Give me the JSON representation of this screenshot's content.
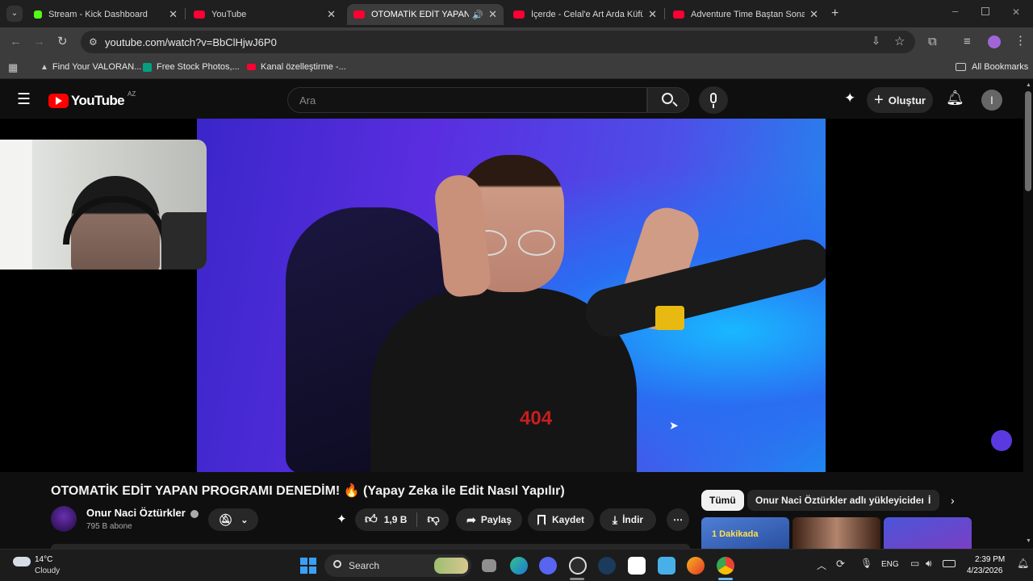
{
  "browser": {
    "tabs": [
      {
        "title": "Stream - Kick Dashboard",
        "icon": "kick-icon",
        "color": "#53fc18"
      },
      {
        "title": "YouTube",
        "icon": "youtube-icon",
        "color": "#ff0033"
      },
      {
        "title": "OTOMATİK EDİT YAPAN PRO",
        "icon": "youtube-icon",
        "color": "#ff0033"
      },
      {
        "title": "İçerde - Celal'e Art Arda Küfürle",
        "icon": "youtube-icon",
        "color": "#ff0033"
      },
      {
        "title": "Adventure Time Baştan Sona Tü",
        "icon": "youtube-icon",
        "color": "#ff0033"
      }
    ],
    "url": "youtube.com/watch?v=BbClHjwJ6P0",
    "bookmarks": [
      {
        "label": "Find Your VALORAN...",
        "icon": "valorant-icon"
      },
      {
        "label": "Free Stock Photos,...",
        "icon": "pexels-icon"
      },
      {
        "label": "Kanal özelleştirme -...",
        "icon": "youtube-icon"
      }
    ],
    "all_bookmarks": "All Bookmarks"
  },
  "youtube": {
    "logo": "YouTube",
    "region": "AZ",
    "search_placeholder": "Ara",
    "create_label": "Oluştur",
    "avatar_letter": "I",
    "video": {
      "shirt_text": "404",
      "title": "OTOMATİK EDİT YAPAN PROGRAMI DENEDİM! 🔥 (Yapay Zeka ile Edit Nasıl Yapılır)",
      "channel": "Onur Naci Öztürkler",
      "subscribers": "795 B abone",
      "likes": "1,9 B",
      "share": "Paylaş",
      "save": "Kaydet",
      "download": "İndir"
    },
    "chips": [
      "Tümü",
      "Onur Naci Öztürkler adlı yükleyiciden",
      "İ"
    ],
    "thumb_caption": "1 Dakikada"
  },
  "taskbar": {
    "weather_temp": "14°C",
    "weather_desc": "Cloudy",
    "search": "Search",
    "language": "ENG",
    "time": "2:39 PM",
    "date": "4/23/2026"
  }
}
